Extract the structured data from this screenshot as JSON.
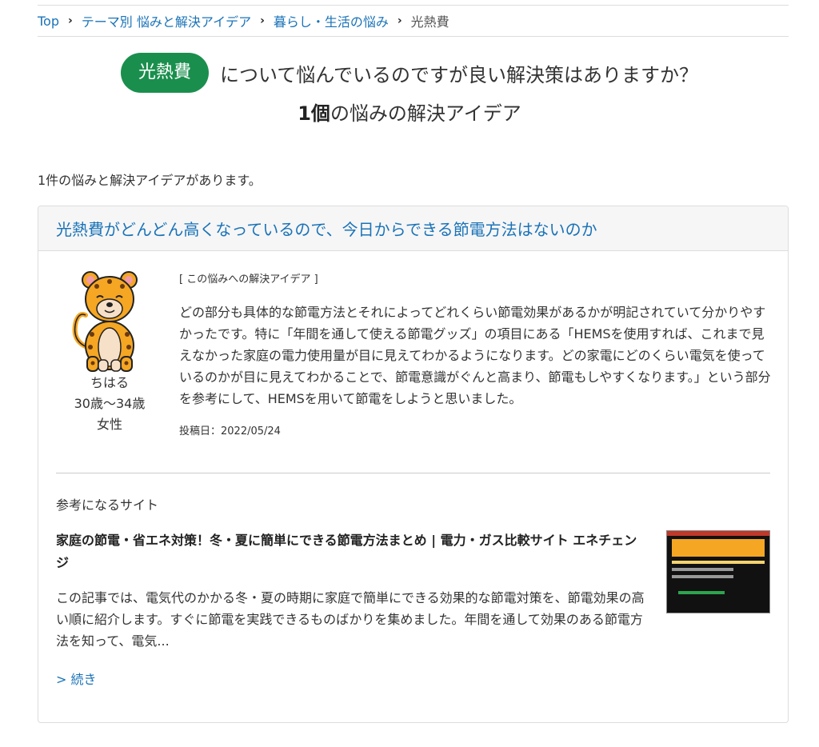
{
  "breadcrumb": {
    "items": [
      "Top",
      "テーマ別 悩みと解決アイデア",
      "暮らし・生活の悩み"
    ],
    "current": "光熱費",
    "separator": "›"
  },
  "headline": {
    "tag": "光熱費",
    "text": "について悩んでいるのですが良い解決策はありますか？",
    "count": "1個",
    "count_suffix": "の悩みの解決アイデア"
  },
  "count_note": "1件の悩みと解決アイデアがあります。",
  "post": {
    "title": "光熱費がどんどん高くなっているので、今日からできる節電方法はないのか",
    "author": {
      "name": "ちはる",
      "age": "30歳〜34歳",
      "gender": "女性",
      "avatar_icon": "cheetah-icon"
    },
    "idea_label": "[ この悩みへの解決アイデア ]",
    "idea_body": "どの部分も具体的な節電方法とそれによってどれくらい節電効果があるかが明記されていて分かりやすかったです。特に「年間を通して使える節電グッズ」の項目にある「HEMSを使用すれば、これまで見えなかった家庭の電力使用量が目に見えてわかるようになります。どの家電にどのくらい電気を使っているのかが目に見えてわかることで、節電意識がぐんと高まり、節電もしやすくなります。」という部分を参考にして、HEMSを用いて節電をしようと思いました。",
    "date": "投稿日：2022/05/24"
  },
  "reference": {
    "heading": "参考になるサイト",
    "title": "家庭の節電・省エネ対策！冬・夏に簡単にできる節電方法まとめ | 電力・ガス比較サイト エネチェンジ",
    "description": "この記事では、電気代のかかる冬・夏の時期に家庭で簡単にできる効果的な節電対策を、節電効果の高い順に紹介します。すぐに節電を実践できるものばかりを集めました。年間を通して効果のある節電方法を知って、電気...",
    "more": "> 続き"
  },
  "colors": {
    "link": "#1a73b8",
    "badge": "#1a8f4d",
    "border": "#dddddd",
    "header_bg": "#f6f6f6"
  }
}
